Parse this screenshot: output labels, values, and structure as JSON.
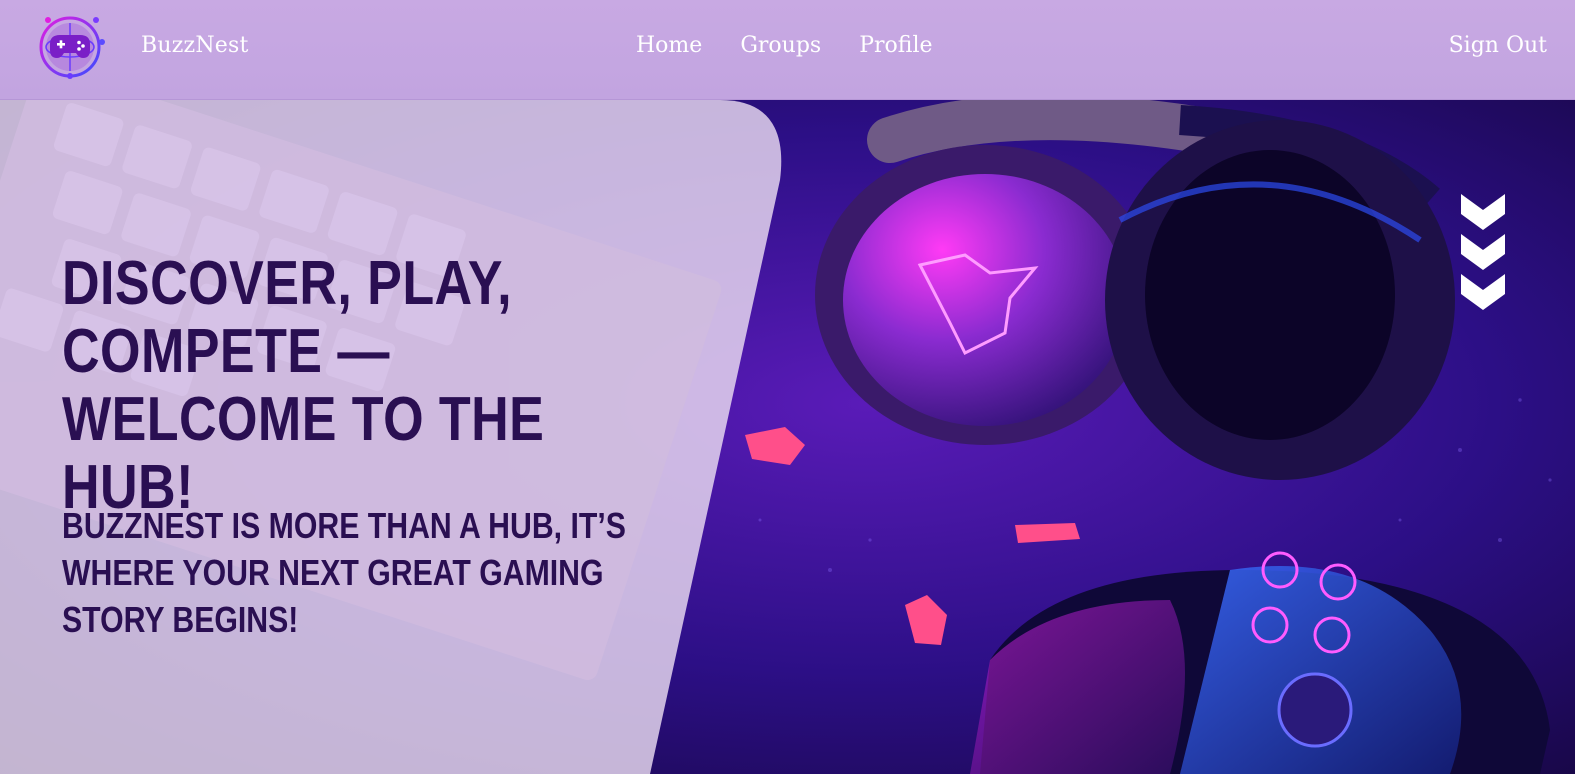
{
  "header": {
    "logo_icon": "gamepad-globe-logo-icon",
    "brand": "BuzzNest",
    "nav": [
      "Home",
      "Groups",
      "Profile"
    ],
    "sign_out": "Sign Out"
  },
  "hero": {
    "title": "Discover, Play, Compete — Welcome to the Hub!",
    "subtitle": "BuzzNest is more than a hub, it’s where your next great gaming story begins!",
    "scroll_icon": "triple-chevron-down-icon",
    "image_subject": "gaming headset, keyboard and controller under neon light"
  },
  "colors": {
    "header_bg": "#c6a8e2",
    "text_dark": "#2a0f52",
    "neon_pink": "#e21cf0",
    "neon_blue": "#2d4bff"
  }
}
